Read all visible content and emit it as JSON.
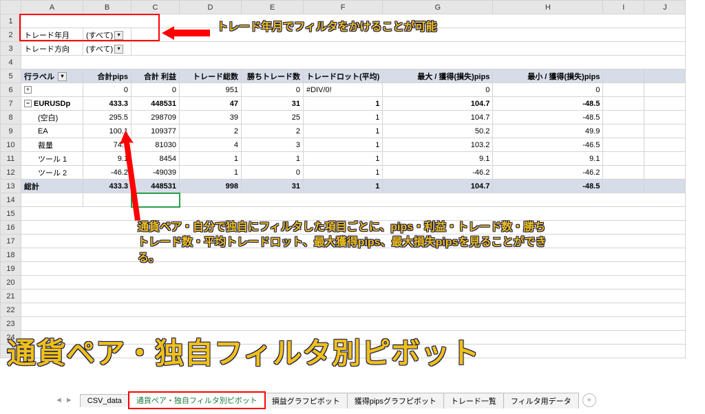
{
  "columns": [
    "A",
    "B",
    "C",
    "D",
    "E",
    "F",
    "G",
    "H",
    "I",
    "J"
  ],
  "rows": [
    "1",
    "2",
    "3",
    "4",
    "5",
    "6",
    "7",
    "8",
    "9",
    "10",
    "11",
    "12",
    "13",
    "14",
    "15",
    "16",
    "17",
    "18",
    "19",
    "20",
    "21",
    "22",
    "23",
    "24",
    "25"
  ],
  "filters": {
    "f1_label": "トレード年月",
    "f1_value": "(すべて)",
    "f2_label": "トレード方向",
    "f2_value": "(すべて)"
  },
  "headers": {
    "rowlabel": "行ラベル",
    "pips": "合計pips",
    "profit": "合計 利益",
    "trades": "トレード総数",
    "wins": "勝ちトレード数",
    "lot": "トレードロット(平均)",
    "maxgain": "最大 / 獲得(損失)pips",
    "mingain": "最小 / 獲得(損失)pips"
  },
  "data": {
    "blankrow": {
      "pips": "0",
      "profit": "0",
      "trades": "951",
      "wins": "0",
      "lot": "#DIV/0!",
      "max": "0",
      "min": "0"
    },
    "grp": {
      "label": "EURUSDp",
      "pips": "433.3",
      "profit": "448531",
      "trades": "47",
      "wins": "31",
      "lot": "1",
      "max": "104.7",
      "min": "-48.5"
    },
    "r1": {
      "label": "(空白)",
      "pips": "295.5",
      "profit": "298709",
      "trades": "39",
      "wins": "25",
      "lot": "1",
      "max": "104.7",
      "min": "-48.5"
    },
    "r2": {
      "label": "EA",
      "pips": "100.1",
      "profit": "109377",
      "trades": "2",
      "wins": "2",
      "lot": "1",
      "max": "50.2",
      "min": "49.9"
    },
    "r3": {
      "label": "裁量",
      "pips": "74.8",
      "profit": "81030",
      "trades": "4",
      "wins": "3",
      "lot": "1",
      "max": "103.2",
      "min": "-46.5"
    },
    "r4": {
      "label": "ツール 1",
      "pips": "9.1",
      "profit": "8454",
      "trades": "1",
      "wins": "1",
      "lot": "1",
      "max": "9.1",
      "min": "9.1"
    },
    "r5": {
      "label": "ツール 2",
      "pips": "-46.2",
      "profit": "-49039",
      "trades": "1",
      "wins": "0",
      "lot": "1",
      "max": "-46.2",
      "min": "-46.2"
    },
    "total": {
      "label": "総計",
      "pips": "433.3",
      "profit": "448531",
      "trades": "998",
      "wins": "31",
      "lot": "1",
      "max": "104.7",
      "min": "-48.5"
    }
  },
  "annotations": {
    "a1": "トレード年月でフィルタをかけることが可能",
    "a2": "通貨ペア・自分で独自にフィルタした項目ごとに、pips・利益・トレード数・勝ちトレード数・平均トレードロット、最大獲得pips、最大損失pipsを見ることができる。",
    "a3": "通貨ペア・独自フィルタ別ピボット"
  },
  "tabs": {
    "t1": "CSV_data",
    "t2": "通貨ペア・独自フィルタ別ピボット",
    "t3": "損益グラフピボット",
    "t4": "獲得pipsグラフピボット",
    "t5": "トレード一覧",
    "t6": "フィルタ用データ",
    "plus": "+"
  }
}
